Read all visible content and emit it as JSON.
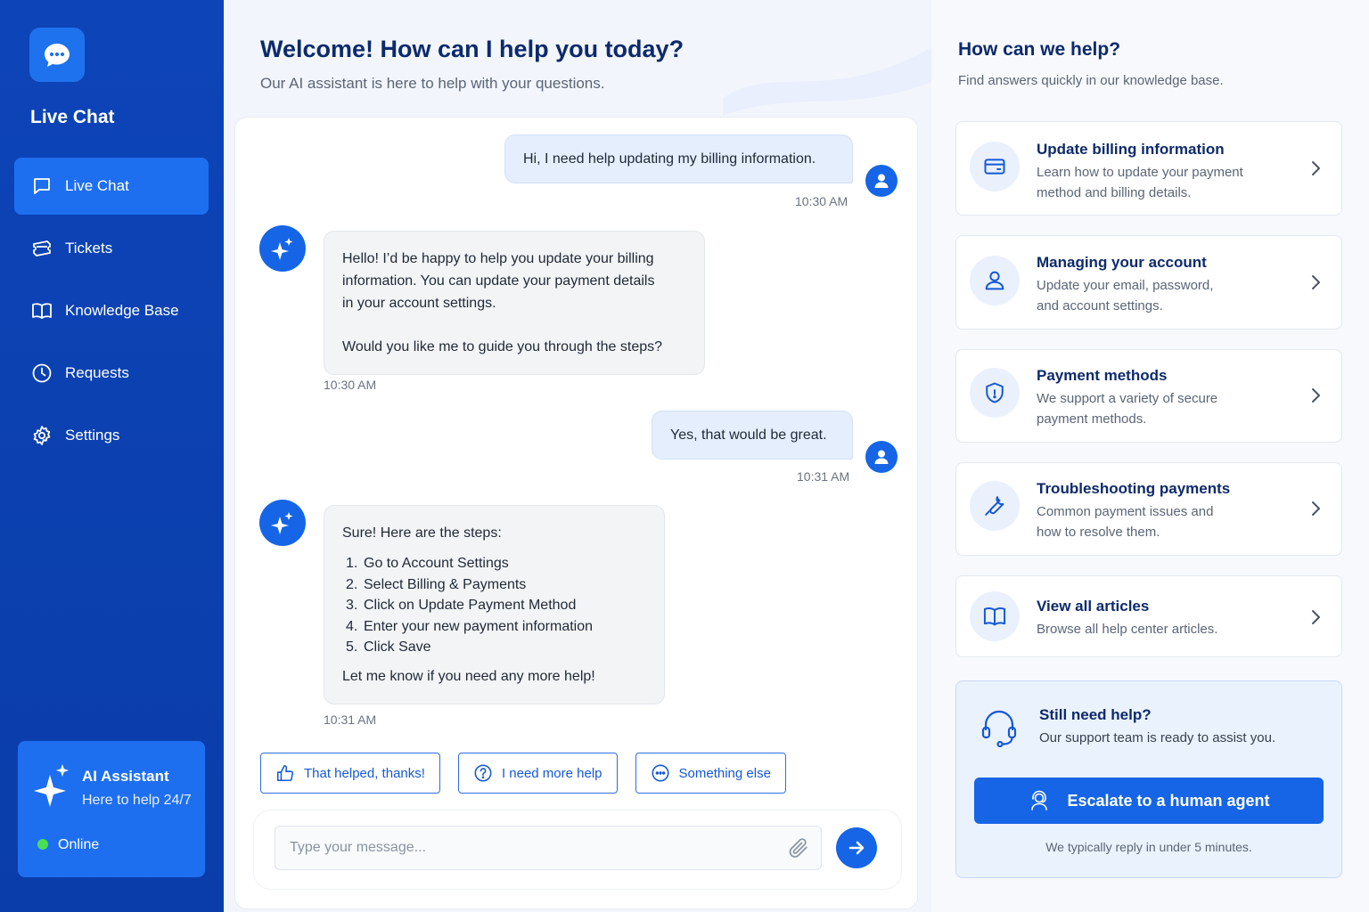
{
  "sidebar": {
    "app_title": "Live Chat",
    "items": [
      {
        "label": "Live Chat",
        "icon": "chat-bubble-icon",
        "active": true
      },
      {
        "label": "Tickets",
        "icon": "ticket-icon",
        "active": false
      },
      {
        "label": "Knowledge Base",
        "icon": "book-icon",
        "active": false
      },
      {
        "label": "Requests",
        "icon": "clock-icon",
        "active": false
      },
      {
        "label": "Settings",
        "icon": "gear-icon",
        "active": false
      }
    ],
    "assistant": {
      "title": "AI Assistant",
      "subtitle": "Here to help 24/7",
      "status": "Online",
      "status_color": "#4ade55"
    }
  },
  "header": {
    "title": "Welcome! How can I help you today?",
    "subtitle": "Our AI assistant is here to help with your questions."
  },
  "chat": {
    "messages": [
      {
        "sender": "user",
        "text": "Hi, I need help updating my billing information.",
        "time": "10:30 AM"
      },
      {
        "sender": "bot",
        "lines": [
          "Hello! I’d be happy to help you update your billing",
          "information. You can update your payment details",
          "in your account settings."
        ],
        "followup": "Would you like me to guide you through the steps?",
        "time": "10:30 AM"
      },
      {
        "sender": "user",
        "text": "Yes, that would be great.",
        "time": "10:31 AM"
      },
      {
        "sender": "bot",
        "intro": "Sure! Here are the steps:",
        "steps": [
          "Go to Account Settings",
          "Select Billing & Payments",
          "Click on Update Payment Method",
          "Enter your new payment information",
          "Click Save"
        ],
        "outro": "Let me know if you need any more help!",
        "time": "10:31 AM"
      }
    ],
    "quick_replies": [
      "That helped, thanks!",
      "I need more help",
      "Something else"
    ],
    "input_placeholder": "Type your message..."
  },
  "help": {
    "title": "How can we help?",
    "subtitle": "Find answers quickly in our knowledge base.",
    "topics": [
      {
        "title": "Update billing information",
        "desc": [
          "Learn how to update your payment",
          "method and billing details."
        ],
        "icon": "credit-card-icon"
      },
      {
        "title": "Managing your account",
        "desc": [
          "Update your email, password,",
          "and account settings."
        ],
        "icon": "user-icon"
      },
      {
        "title": "Payment methods",
        "desc": [
          "We support a variety of secure",
          "payment methods."
        ],
        "icon": "shield-icon"
      },
      {
        "title": "Troubleshooting payments",
        "desc": [
          "Common payment issues and",
          "how to resolve them."
        ],
        "icon": "wrench-icon"
      },
      {
        "title": "View all articles",
        "desc": [
          "Browse all help center articles."
        ],
        "icon": "book-open-icon"
      }
    ],
    "still": {
      "title": "Still need help?",
      "subtitle": "Our support team is ready to assist you.",
      "button": "Escalate to a human agent",
      "note": "We typically reply in under 5 minutes."
    }
  },
  "colors": {
    "sidebar": "#0d44b8",
    "accent": "#1565e6",
    "active_nav": "#1e6ff0",
    "heading": "#0d2a6b"
  }
}
